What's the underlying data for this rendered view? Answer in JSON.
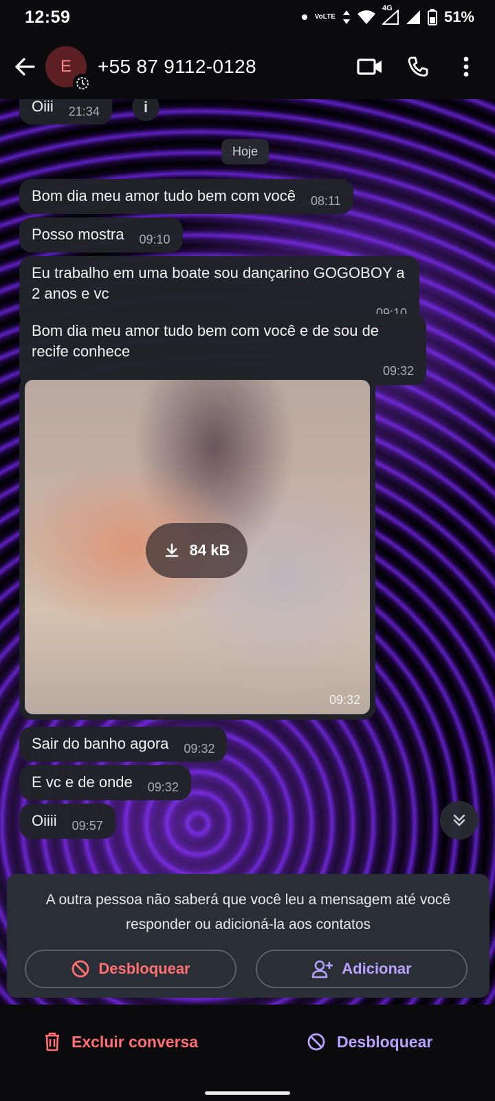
{
  "status_bar": {
    "time": "12:59",
    "volte_top": "Vo",
    "volte_bottom": "LTE",
    "network": "4G",
    "battery": "51%"
  },
  "header": {
    "avatar_initial": "E",
    "contact_name": "+55 87 9112-0128"
  },
  "chat": {
    "date_chip": "Hoje",
    "messages": [
      {
        "text": "Oiii",
        "time": "21:34"
      },
      {
        "text": "Bom dia meu amor tudo bem com você",
        "time": "08:11"
      },
      {
        "text": "Posso mostra",
        "time": "09:10"
      },
      {
        "text": "Eu trabalho em uma boate sou dançarino GOGOBOY a 2 anos e vc",
        "time": "09:10"
      },
      {
        "text": "Bom dia meu amor tudo bem com você e de sou de recife conhece",
        "time": "09:32"
      },
      {
        "text": "Sair do banho agora",
        "time": "09:32"
      },
      {
        "text": "E vc e de onde",
        "time": "09:32"
      },
      {
        "text": "Oiiii",
        "time": "09:57"
      }
    ],
    "image_message": {
      "size": "84 kB",
      "time": "09:32"
    }
  },
  "notice": {
    "text": "A outra pessoa não saberá que você leu a mensagem até você responder ou adicioná-la aos contatos",
    "unblock_label": "Desbloquear",
    "add_label": "Adicionar"
  },
  "bottom_bar": {
    "delete_label": "Excluir conversa",
    "unblock_label": "Desbloquear"
  },
  "colors": {
    "danger": "#ff6f73",
    "accent": "#b7a2ff",
    "bubble": "#202328",
    "bar": "#0b0b0d"
  }
}
